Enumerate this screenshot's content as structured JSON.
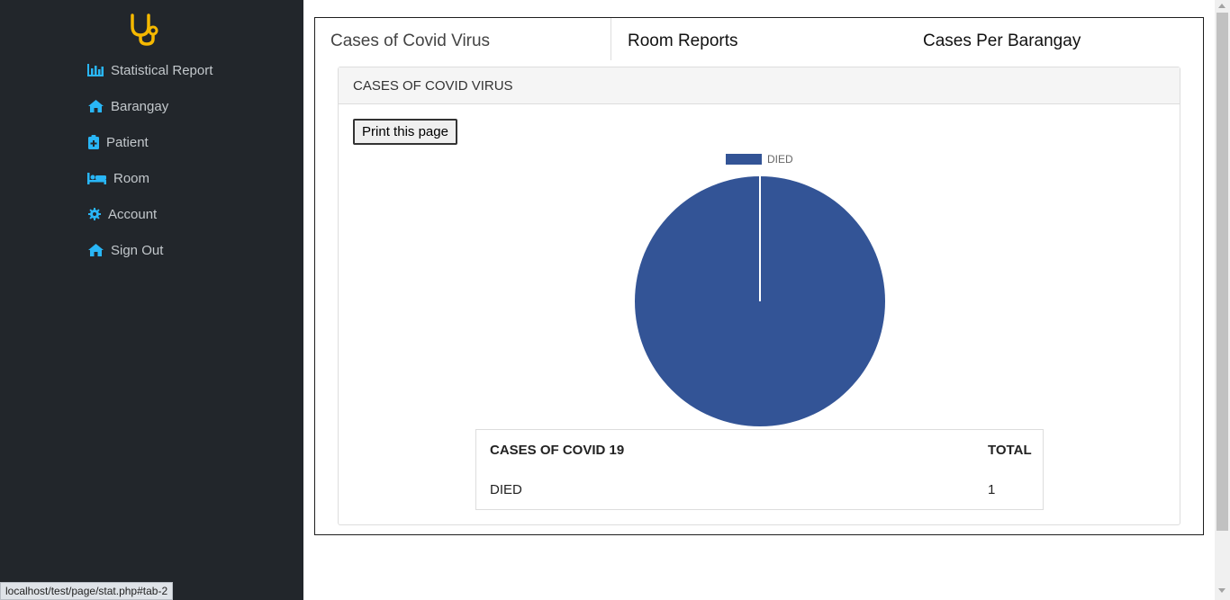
{
  "sidebar": {
    "logo_icon": "stethoscope-icon",
    "items": [
      {
        "label": "Statistical Report",
        "icon": "bar-chart-icon"
      },
      {
        "label": "Barangay",
        "icon": "home-icon"
      },
      {
        "label": "Patient",
        "icon": "medkit-icon"
      },
      {
        "label": "Room",
        "icon": "bed-icon"
      },
      {
        "label": "Account",
        "icon": "gear-icon"
      },
      {
        "label": "Sign Out",
        "icon": "home-icon"
      }
    ]
  },
  "tabs": [
    {
      "label": "Cases of Covid Virus"
    },
    {
      "label": "Room Reports"
    },
    {
      "label": "Cases Per Barangay"
    }
  ],
  "panel": {
    "heading": "CASES OF COVID VIRUS",
    "print_button": "Print this page"
  },
  "chart_data": {
    "type": "pie",
    "labels": [
      "DIED"
    ],
    "values": [
      1
    ],
    "colors": [
      "#335496"
    ],
    "legend_position": "top"
  },
  "table": {
    "headers": [
      "CASES OF COVID 19",
      "TOTAL"
    ],
    "rows": [
      [
        "DIED",
        "1"
      ]
    ]
  },
  "status_bar": {
    "url": "localhost/test/page/stat.php#tab-2"
  },
  "colors": {
    "sidebar_bg": "#22262b",
    "sidebar_icon": "#29b6f6",
    "logo": "#f5b800",
    "pie_fill": "#335496"
  }
}
